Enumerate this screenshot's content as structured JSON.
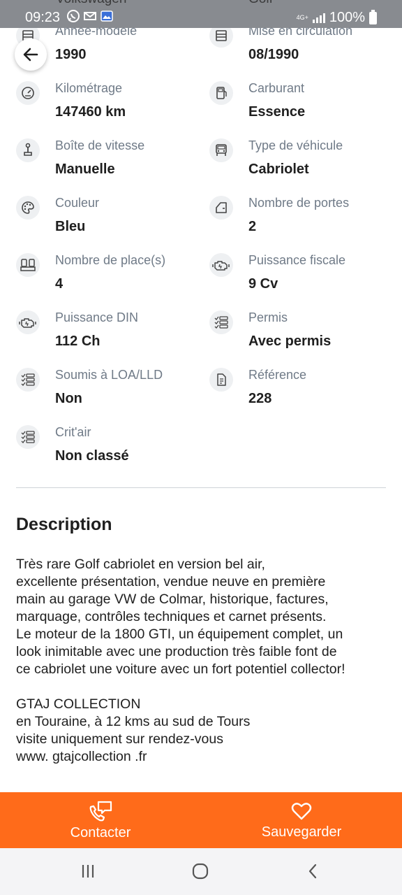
{
  "status_bar": {
    "time": "09:23",
    "battery": "100%",
    "network": "4G+",
    "clipped_titles": [
      "Volkswagen",
      "Golf"
    ]
  },
  "specs": [
    {
      "label": "Année-modèle",
      "value": "1990",
      "icon": "calendar-icon"
    },
    {
      "label": "Mise en circulation",
      "value": "08/1990",
      "icon": "calendar-icon"
    },
    {
      "label": "Kilométrage",
      "value": "147460 km",
      "icon": "speedometer-icon"
    },
    {
      "label": "Carburant",
      "value": "Essence",
      "icon": "fuel-pump-icon"
    },
    {
      "label": "Boîte de vitesse",
      "value": "Manuelle",
      "icon": "gear-stick-icon"
    },
    {
      "label": "Type de véhicule",
      "value": "Cabriolet",
      "icon": "car-front-icon"
    },
    {
      "label": "Couleur",
      "value": "Bleu",
      "icon": "palette-icon"
    },
    {
      "label": "Nombre de portes",
      "value": "2",
      "icon": "door-icon"
    },
    {
      "label": "Nombre de place(s)",
      "value": "4",
      "icon": "seats-icon"
    },
    {
      "label": "Puissance fiscale",
      "value": "9 Cv",
      "icon": "engine-icon"
    },
    {
      "label": "Puissance DIN",
      "value": "112 Ch",
      "icon": "engine-icon"
    },
    {
      "label": "Permis",
      "value": "Avec permis",
      "icon": "checklist-icon"
    },
    {
      "label": "Soumis à LOA/LLD",
      "value": "Non",
      "icon": "checklist-icon"
    },
    {
      "label": "Référence",
      "value": "228",
      "icon": "document-icon"
    },
    {
      "label": "Crit'air",
      "value": "Non classé",
      "icon": "checklist-icon"
    }
  ],
  "description": {
    "title": "Description",
    "body": "Très rare Golf cabriolet en version bel air,\nexcellente présentation, vendue neuve en première\nmain au garage VW de Colmar, historique, factures,\nmarquage, contrôles techniques  et carnet présents.\nLe moteur de la 1800 GTI, un équipement complet,  un\nlook inimitable avec une production très faible font de\nce cabriolet une voiture avec un fort potentiel collector!\n\nGTAJ COLLECTION\nen Touraine, à 12 kms au sud de  Tours\nvisite uniquement sur rendez-vous\nwww. gtajcollection .fr"
  },
  "actions": {
    "contact_label": "Contacter",
    "save_label": "Sauvegarder"
  },
  "colors": {
    "accent": "#ff6b1a",
    "label_gray": "#6f7a87"
  }
}
